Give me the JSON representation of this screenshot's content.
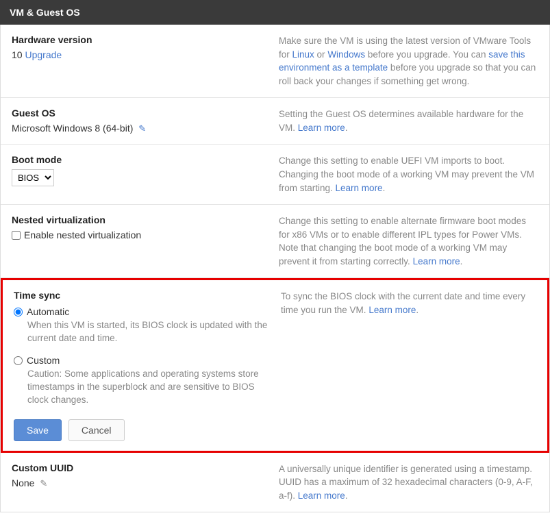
{
  "header": {
    "title": "VM & Guest OS"
  },
  "hardware": {
    "title": "Hardware version",
    "value": "10",
    "upgrade": "Upgrade",
    "desc_1": "Make sure the VM is using the latest version of VMware Tools for ",
    "linux": "Linux",
    "or": " or ",
    "windows": "Windows",
    "desc_2": " before you upgrade. You can ",
    "save_link": "save this environment as a template",
    "desc_3": " before you upgrade so that you can roll back your changes if something get wrong."
  },
  "guest_os": {
    "title": "Guest OS",
    "value": "Microsoft Windows 8 (64-bit)",
    "desc": "Setting the Guest OS determines available hardware for the VM. ",
    "learn_more": "Learn more"
  },
  "boot_mode": {
    "title": "Boot mode",
    "selected": "BIOS",
    "desc": "Change this setting to enable UEFI VM imports to boot. Changing the boot mode of a working VM may prevent the VM from starting. ",
    "learn_more": "Learn more"
  },
  "nested": {
    "title": "Nested virtualization",
    "label": "Enable nested virtualization",
    "desc": "Change this setting to enable alternate firmware boot modes for x86 VMs or to enable different IPL types for Power VMs. Note that changing the boot mode of a working VM may prevent it from starting correctly. ",
    "learn_more": "Learn more"
  },
  "time_sync": {
    "title": "Time sync",
    "auto_label": "Automatic",
    "auto_desc": "When this VM is started, its BIOS clock is updated with the current date and time.",
    "custom_label": "Custom",
    "custom_desc": "Caution: Some applications and operating systems store timestamps in the superblock and are sensitive to BIOS clock changes.",
    "save": "Save",
    "cancel": "Cancel",
    "desc": "To sync the BIOS clock with the current date and time every time you run the VM. ",
    "learn_more": "Learn more"
  },
  "uuid": {
    "title": "Custom UUID",
    "value": "None",
    "desc": "A universally unique identifier is generated using a timestamp. UUID has a maximum of 32 hexadecimal characters (0-9, A-F, a-f). ",
    "learn_more": "Learn more"
  }
}
